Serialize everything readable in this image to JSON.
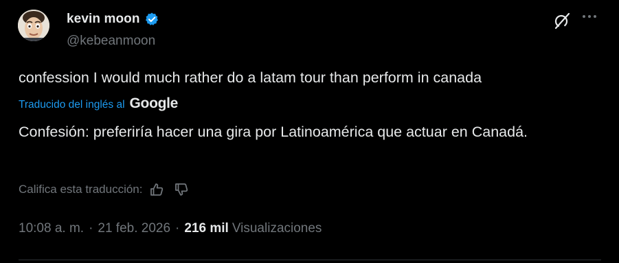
{
  "author": {
    "display_name": "kevin moon",
    "handle": "@kebeanmoon",
    "verified": true
  },
  "tweet": {
    "original_text": "confession I would much rather do a latam tour than perform in canada",
    "translated_by_label": "Traducido del inglés al",
    "translator_brand": "Google",
    "translated_text": "Confesión: preferiría hacer una gira por Latinoamérica que actuar en Canadá.",
    "rate_label": "Califica esta traducción:",
    "time": "10:08 a. m.",
    "date": "21 feb. 2026",
    "separator": "·",
    "views_count": "216 mil",
    "views_label": "Visualizaciones"
  },
  "icons": {
    "verified": "verified-badge-icon",
    "grok": "grok-icon",
    "more": "more-options-icon",
    "thumbs_up": "thumbs-up-icon",
    "thumbs_down": "thumbs-down-icon"
  },
  "colors": {
    "background": "#000000",
    "text_primary": "#e7e9ea",
    "text_secondary": "#71767b",
    "accent": "#1d9bf0",
    "divider": "#2f3336"
  }
}
